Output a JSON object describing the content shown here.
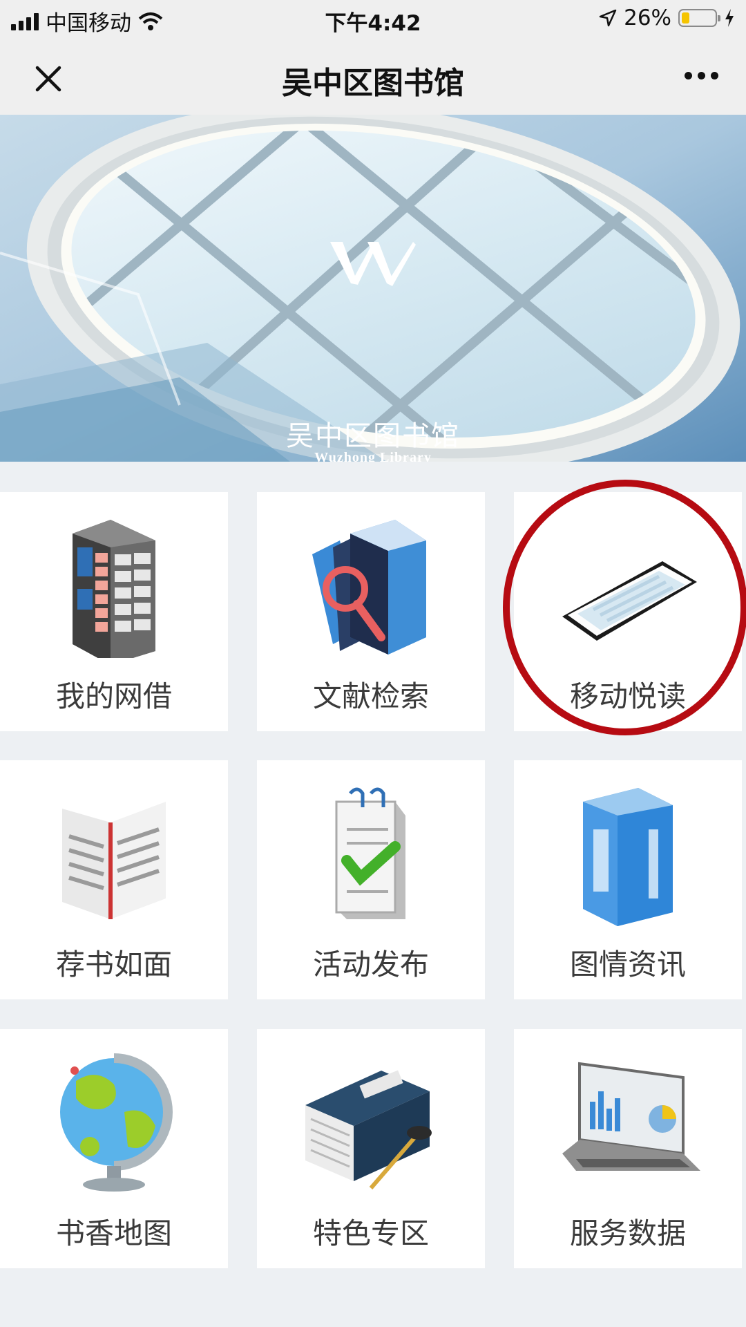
{
  "status_bar": {
    "carrier": "中国移动",
    "time": "下午4:42",
    "battery": "26%",
    "battery_level": 0.26
  },
  "nav": {
    "title": "吴中区图书馆",
    "close_icon": "close-icon",
    "more_icon": "more-icon"
  },
  "banner": {
    "title": "吴中区图书馆",
    "subtitle": "Wuzhong Library"
  },
  "grid": {
    "items": [
      {
        "label": "我的网借",
        "icon": "locker-icon"
      },
      {
        "label": "文献检索",
        "icon": "book-search-icon"
      },
      {
        "label": "移动悦读",
        "icon": "phone-icon"
      },
      {
        "label": "荐书如面",
        "icon": "open-book-icon"
      },
      {
        "label": "活动发布",
        "icon": "calendar-check-icon"
      },
      {
        "label": "图情资讯",
        "icon": "info-book-icon"
      },
      {
        "label": "书香地图",
        "icon": "globe-icon"
      },
      {
        "label": "特色专区",
        "icon": "special-book-icon"
      },
      {
        "label": "服务数据",
        "icon": "laptop-chart-icon"
      }
    ]
  },
  "colors": {
    "highlight": "#b60b12",
    "background": "#edf0f3",
    "tile": "#ffffff"
  }
}
